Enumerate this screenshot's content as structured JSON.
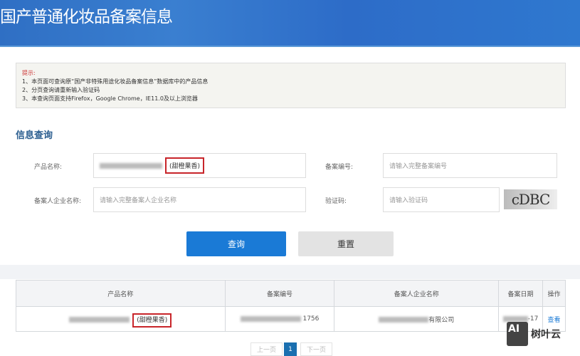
{
  "header": {
    "title": "国产普通化妆品备案信息"
  },
  "notice": {
    "tip": "提示:",
    "lines": [
      "1、本页面可查询原“国产非特殊用途化妆品备案信息”数据库中的产品信息",
      "2、分页查询请重新输入验证码",
      "3、本查询页面支持Firefox，Google Chrome，IE11.0及以上浏览器"
    ]
  },
  "search": {
    "section_title": "信息查询",
    "product_label": "产品名称:",
    "product_value_suffix": "(甜橙果香)",
    "record_no_label": "备案编号:",
    "record_no_placeholder": "请输入完整备案编号",
    "company_label": "备案人企业名称:",
    "company_placeholder": "请输入完整备案人企业名称",
    "captcha_label": "验证码:",
    "captcha_placeholder": "请输入验证码",
    "captcha_text": "cDBC",
    "query_button": "查询",
    "reset_button": "重置"
  },
  "table": {
    "headers": [
      "产品名称",
      "备案编号",
      "备案人企业名称",
      "备案日期",
      "操作"
    ],
    "rows": [
      {
        "product_suffix": "(甜橙果香)",
        "record_no_suffix": "1756",
        "company_suffix": "有限公司",
        "date_suffix": "-17",
        "action": "查看"
      }
    ]
  },
  "pagination": {
    "prev": "上一页",
    "current": "1",
    "next": "下一页"
  },
  "watermark": {
    "logo": "AI",
    "text": "树叶云"
  },
  "colors": {
    "primary": "#1a7ad6",
    "highlight": "#c8252a"
  }
}
